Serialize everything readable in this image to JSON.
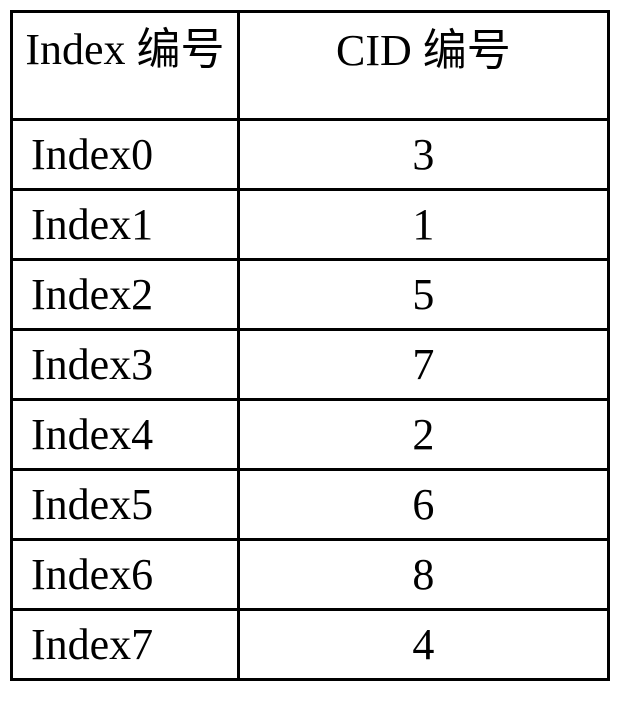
{
  "chart_data": {
    "type": "table",
    "headers": {
      "index": "Index 编号",
      "cid": "CID 编号"
    },
    "rows": [
      {
        "index": "Index0",
        "cid": "3"
      },
      {
        "index": "Index1",
        "cid": "1"
      },
      {
        "index": "Index2",
        "cid": "5"
      },
      {
        "index": "Index3",
        "cid": "7"
      },
      {
        "index": "Index4",
        "cid": "2"
      },
      {
        "index": "Index5",
        "cid": "6"
      },
      {
        "index": "Index6",
        "cid": "8"
      },
      {
        "index": "Index7",
        "cid": "4"
      }
    ]
  }
}
